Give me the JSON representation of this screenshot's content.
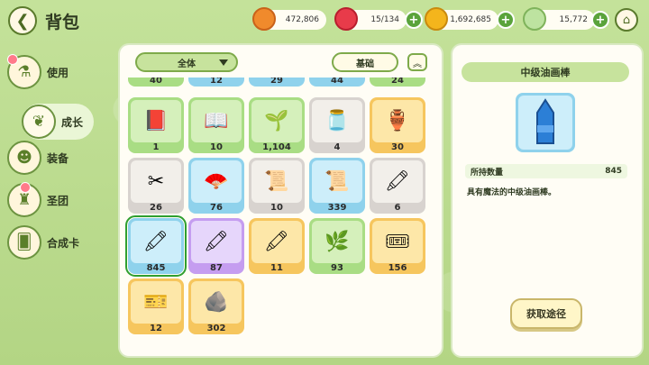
{
  "header": {
    "back_icon": "back-arrow-icon",
    "title": "背包",
    "home_icon": "home-icon"
  },
  "resources": [
    {
      "name": "orange-coin",
      "value": "472,806",
      "color": "#f08a2c",
      "has_plus": false
    },
    {
      "name": "red-gem",
      "value": "15/134",
      "color": "#e83b4a",
      "has_plus": true
    },
    {
      "name": "gold-coin",
      "value": "1,692,685",
      "color": "#f4b51c",
      "has_plus": true
    },
    {
      "name": "leaf-crystal",
      "value": "15,772",
      "color": "#8bc46a",
      "has_plus": true
    }
  ],
  "sidebar": {
    "items": [
      {
        "label": "使用",
        "icon": "potion-icon",
        "active": false
      },
      {
        "label": "成长",
        "icon": "growth-icon",
        "active": true
      },
      {
        "label": "装备",
        "icon": "cookie-icon",
        "active": false
      },
      {
        "label": "圣团",
        "icon": "guild-icon",
        "active": false
      },
      {
        "label": "合成卡",
        "icon": "card-icon",
        "active": false
      }
    ]
  },
  "filters": {
    "category": "全体",
    "sort": "基础",
    "sort_toggle_icon": "double-chevron-up-icon"
  },
  "grid": {
    "partial_top": [
      "40",
      "12",
      "29",
      "44",
      "24"
    ],
    "items": [
      {
        "count": "1",
        "rarity": "green",
        "icon": "book-icon"
      },
      {
        "count": "10",
        "rarity": "green",
        "icon": "book-icon"
      },
      {
        "count": "1,104",
        "rarity": "green",
        "icon": "leaf-book-icon"
      },
      {
        "count": "4",
        "rarity": "gray",
        "icon": "jar-icon"
      },
      {
        "count": "30",
        "rarity": "orange",
        "icon": "jar-icon"
      },
      {
        "count": "26",
        "rarity": "gray",
        "icon": "fan-icon"
      },
      {
        "count": "76",
        "rarity": "blue",
        "icon": "fan-icon"
      },
      {
        "count": "10",
        "rarity": "gray",
        "icon": "scroll-icon"
      },
      {
        "count": "339",
        "rarity": "blue",
        "icon": "scroll-icon"
      },
      {
        "count": "6",
        "rarity": "gray",
        "icon": "crayon-icon"
      },
      {
        "count": "845",
        "rarity": "blue",
        "icon": "crayon-icon",
        "selected": true
      },
      {
        "count": "87",
        "rarity": "purple",
        "icon": "crayon-icon"
      },
      {
        "count": "11",
        "rarity": "orange",
        "icon": "crayon-icon"
      },
      {
        "count": "93",
        "rarity": "green",
        "icon": "leaf-book-icon"
      },
      {
        "count": "156",
        "rarity": "orange",
        "icon": "ticket-icon"
      },
      {
        "count": "12",
        "rarity": "orange",
        "icon": "ticket-icon"
      },
      {
        "count": "302",
        "rarity": "orange",
        "icon": "stone-tablet-icon"
      }
    ]
  },
  "detail": {
    "title": "中级油画棒",
    "icon": "crayon-icon",
    "owned_label": "所持数量",
    "owned_value": "845",
    "description": "具有魔法的中级油画棒。",
    "get_button": "获取途径"
  }
}
